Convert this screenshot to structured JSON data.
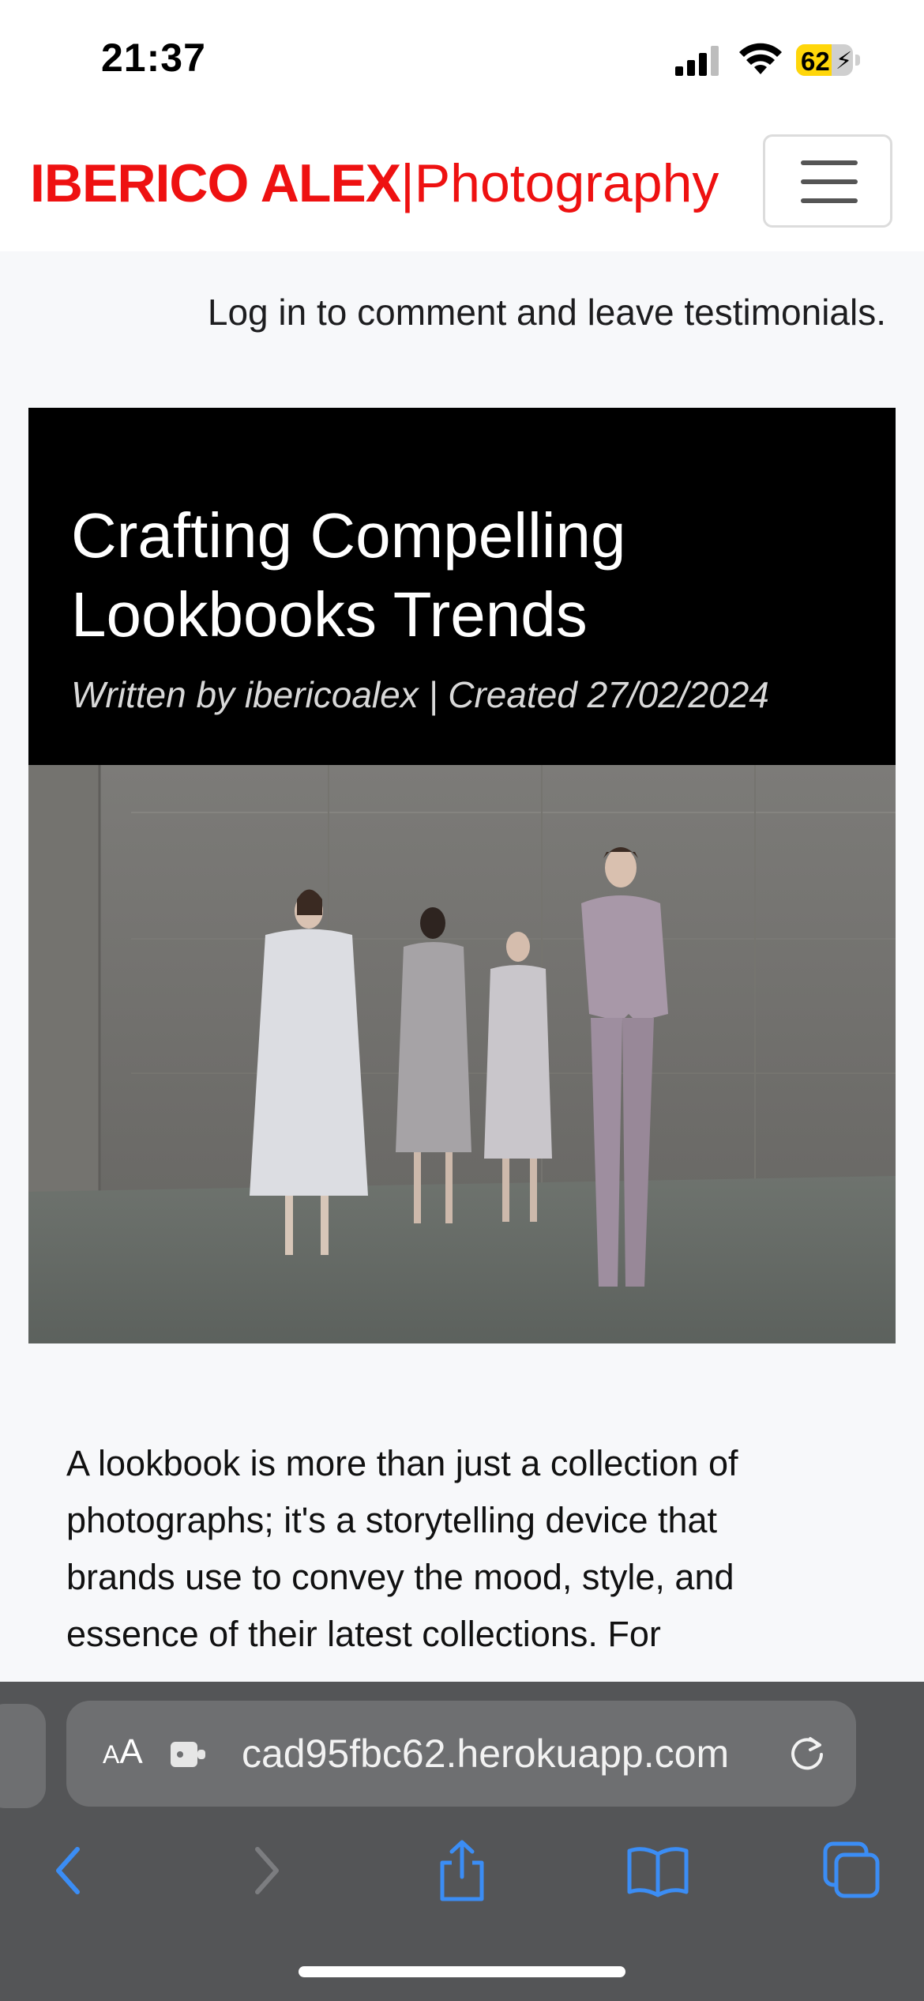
{
  "status_bar": {
    "time": "21:37",
    "battery": "62",
    "battery_level": 0.62
  },
  "navbar": {
    "brand_main": "IBERICO ALEX",
    "brand_separator": "|",
    "brand_sub": "Photography"
  },
  "login_note": "Log in to comment and leave testimonials.",
  "article": {
    "title": "Crafting Compelling Lookbooks Trends",
    "meta": "Written by ibericoalex | Created 27/02/2024",
    "intro": "A lookbook is more than just a collection of photographs; it's a storytelling device that brands use to convey the mood, style, and essence of their latest collections. For"
  },
  "browser": {
    "aa_small": "A",
    "aa_large": "A",
    "url": "cad95fbc62.herokuapp.com"
  },
  "icons": {
    "menu": "hamburger-icon",
    "extension": "extension-icon",
    "reload": "reload-icon",
    "back": "chevron-left-icon",
    "forward": "chevron-right-icon",
    "share": "share-icon",
    "bookmarks": "book-icon",
    "tabs": "tabs-icon"
  },
  "colors": {
    "brand": "#ee1111",
    "tool_accent": "#3b8df5"
  }
}
